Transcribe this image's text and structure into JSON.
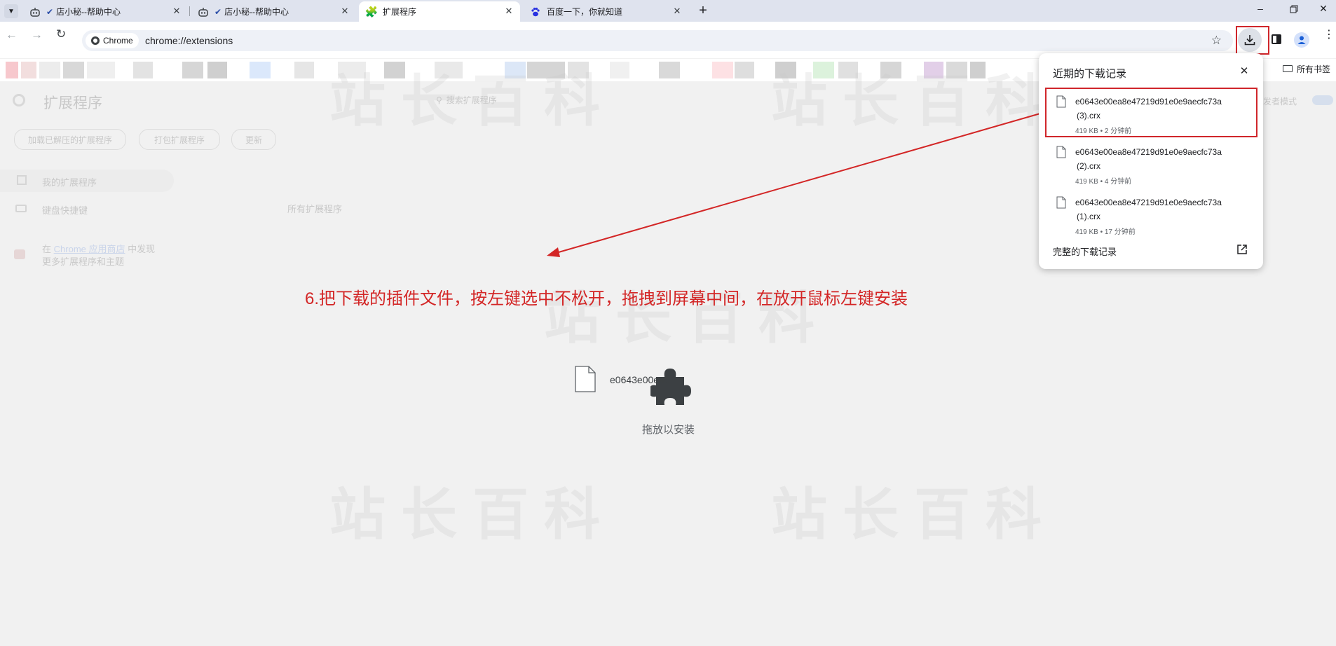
{
  "tabs": [
    {
      "title": "店小秘--帮助中心",
      "active": false
    },
    {
      "title": "店小秘--帮助中心",
      "active": false
    },
    {
      "title": "扩展程序",
      "active": true
    },
    {
      "title": "百度一下，你就知道",
      "active": false
    }
  ],
  "toolbar": {
    "chip_label": "Chrome",
    "url": "chrome://extensions",
    "bookmarks_folder": "所有书签"
  },
  "extensions_page": {
    "title": "扩展程序",
    "search_placeholder": "搜索扩展程序",
    "dev_mode_label": "开发者模式",
    "buttons": [
      "加载已解压的扩展程序",
      "打包扩展程序",
      "更新"
    ],
    "nav": [
      {
        "label": "我的扩展程序"
      },
      {
        "label": "键盘快捷键"
      }
    ],
    "store_line1_prefix": "在",
    "store_link": "Chrome 应用商店",
    "store_line1_suffix": "中发现",
    "store_line2": "更多扩展程序和主题",
    "section_label": "所有扩展程序"
  },
  "downloads": {
    "header": "近期的下载记录",
    "items": [
      {
        "name_line1": "e0643e00ea8e47219d91e0e9aecfc73a",
        "name_line2": "(3).crx",
        "meta": "419 KB • 2 分钟前"
      },
      {
        "name_line1": "e0643e00ea8e47219d91e0e9aecfc73a",
        "name_line2": "(2).crx",
        "meta": "419 KB • 4 分钟前"
      },
      {
        "name_line1": "e0643e00ea8e47219d91e0e9aecfc73a",
        "name_line2": "(1).crx",
        "meta": "419 KB • 17 分钟前"
      }
    ],
    "footer_link": "完整的下载记录"
  },
  "drop_zone": {
    "dragged_file": "e0643e00ea8...",
    "drop_label": "拖放以安装"
  },
  "instruction": "6.把下载的插件文件，按左键选中不松开，拖拽到屏幕中间，在放开鼠标左键安装",
  "colors": {
    "annotation_red": "#d32626",
    "tabstrip": "#dfe3ee",
    "page_bg": "#f1f1f1"
  }
}
